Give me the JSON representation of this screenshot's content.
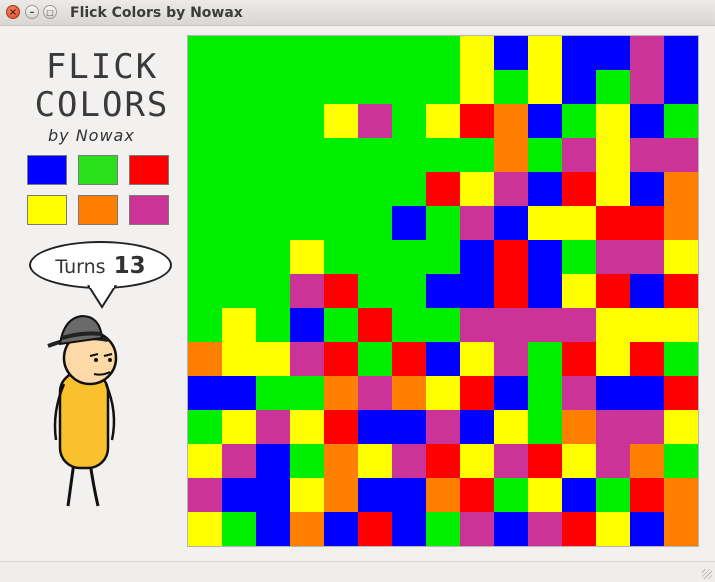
{
  "window": {
    "title": "Flick Colors by Nowax"
  },
  "logo": {
    "line1": "FLICK",
    "line2": "COLORS",
    "line3": "by Nowax"
  },
  "turns": {
    "label": "Turns",
    "value": "13"
  },
  "palette": [
    {
      "name": "blue",
      "color": "#0000ff"
    },
    {
      "name": "green",
      "color": "#2be01b"
    },
    {
      "name": "red",
      "color": "#ff0000"
    },
    {
      "name": "yellow",
      "color": "#ffff00"
    },
    {
      "name": "orange",
      "color": "#ff8000"
    },
    {
      "name": "magenta",
      "color": "#cc3399"
    }
  ],
  "colors": {
    "G": "#00ee00",
    "B": "#0000ff",
    "Y": "#ffff00",
    "R": "#ff0000",
    "O": "#ff8000",
    "M": "#cc3399"
  },
  "board": [
    "GGGGGGGGYBYBBMB",
    "GGGGGGGGYGYBGMB",
    "GGGGYMGYROBGYBG",
    "GGGGGGGGGOGMYMM",
    "GGGGGGGRYMBRYBO",
    "GGGGGGBGMBYYRRO",
    "GGGYGGGGBRBGMMY",
    "GGGMRGGBBRBYRBR",
    "GYGBGRGGMMMMYYY",
    "OYYMRGRBYMGRYRG",
    "BBGGOMOYRBGMBBR",
    "GYMYRBBMBYGOMMY",
    "YMBGOYMRYMRYMOG",
    "MBBYOBBORGYBGRO",
    "YGBOBRBGMBMRYBO"
  ]
}
